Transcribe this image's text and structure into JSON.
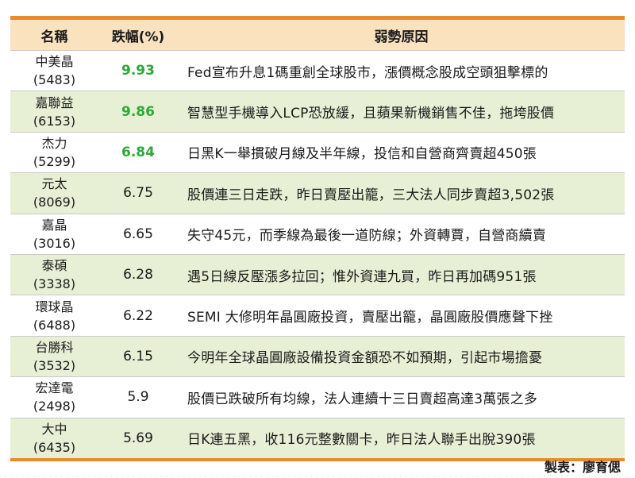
{
  "headers": {
    "name": "名稱",
    "change": "跌幅(%)",
    "reason": "弱勢原因"
  },
  "rows": [
    {
      "name": "中美晶",
      "code": "(5483)",
      "change": "9.93",
      "highlight": true,
      "reason": "Fed宣布升息1碼重創全球股市，漲價概念股成空頭狙擊標的"
    },
    {
      "name": "嘉聯益",
      "code": "(6153)",
      "change": "9.86",
      "highlight": true,
      "reason": "智慧型手機導入LCP恐放緩，且蘋果新機銷售不佳，拖垮股價"
    },
    {
      "name": "杰力",
      "code": "(5299)",
      "change": "6.84",
      "highlight": true,
      "reason": "日黑K一舉摜破月線及半年線，投信和自營商齊賣超450張"
    },
    {
      "name": "元太",
      "code": "(8069)",
      "change": "6.75",
      "highlight": false,
      "reason": "股價連三日走跌，昨日賣壓出籠，三大法人同步賣超3,502張"
    },
    {
      "name": "嘉晶",
      "code": "(3016)",
      "change": "6.65",
      "highlight": false,
      "reason": "失守45元，而季線為最後一道防線；外資轉賈，自營商續賣"
    },
    {
      "name": "泰碩",
      "code": "(3338)",
      "change": "6.28",
      "highlight": false,
      "reason": "遇5日線反壓漲多拉回；惟外資連九買，昨日再加碼951張"
    },
    {
      "name": "環球晶",
      "code": "(6488)",
      "change": "6.22",
      "highlight": false,
      "reason": "SEMI 大修明年晶圓廠投資，賣壓出籠，晶圓廠股價應聲下挫"
    },
    {
      "name": "台勝科",
      "code": "(3532)",
      "change": "6.15",
      "highlight": false,
      "reason": "今明年全球晶圓廠設備投資金額恐不如預期，引起市場擔憂"
    },
    {
      "name": "宏達電",
      "code": "(2498)",
      "change": "5.9",
      "highlight": false,
      "reason": "股價已跌破所有均線，法人連續十三日賣超高達3萬張之多"
    },
    {
      "name": "大中",
      "code": "(6435)",
      "change": "5.69",
      "highlight": false,
      "reason": "日K連五黑，收116元整數關卡，昨日法人聯手出脫390張"
    }
  ],
  "credit": "製表：廖育偲",
  "colors": {
    "accent": "#e98b2a",
    "header_bg": "#fbe2bf",
    "alt_row_bg": "#e7f0d5",
    "highlight_text": "#2ea836"
  }
}
